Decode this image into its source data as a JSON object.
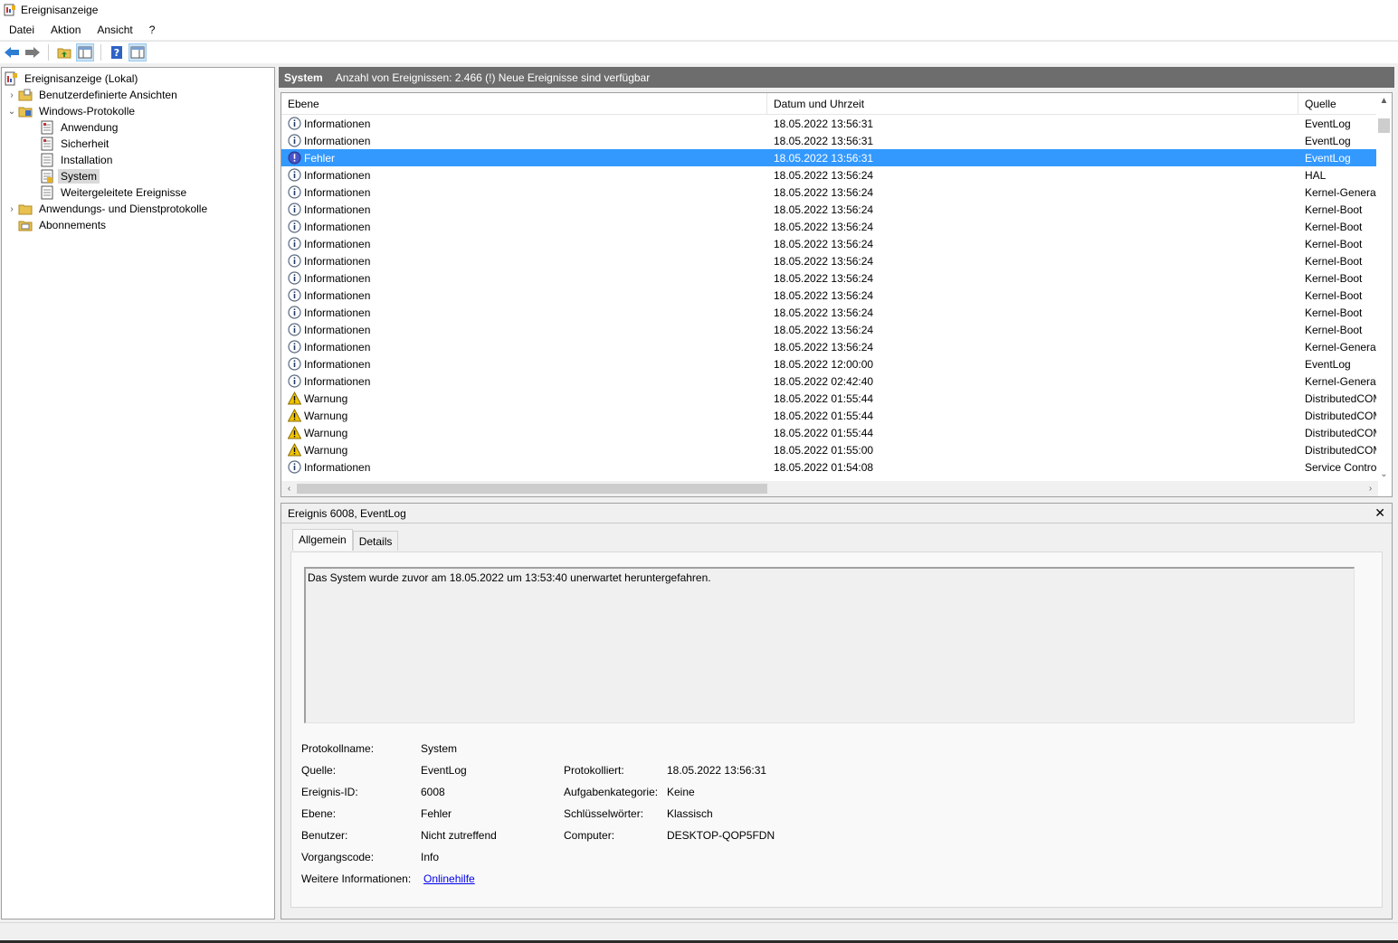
{
  "window": {
    "title": "Ereignisanzeige"
  },
  "menu": [
    "Datei",
    "Aktion",
    "Ansicht",
    "?"
  ],
  "tree": [
    {
      "label": "Ereignisanzeige (Lokal)",
      "level": 0,
      "arrow": "",
      "icon": "event-viewer-icon"
    },
    {
      "label": "Benutzerdefinierte Ansichten",
      "level": 1,
      "arrow": "›",
      "icon": "folder-icon"
    },
    {
      "label": "Windows-Protokolle",
      "level": 1,
      "arrow": "⌄",
      "icon": "folder-icon"
    },
    {
      "label": "Anwendung",
      "level": 2,
      "arrow": "",
      "icon": "log-icon"
    },
    {
      "label": "Sicherheit",
      "level": 2,
      "arrow": "",
      "icon": "log-icon"
    },
    {
      "label": "Installation",
      "level": 2,
      "arrow": "",
      "icon": "log-icon"
    },
    {
      "label": "System",
      "level": 2,
      "arrow": "",
      "icon": "log-icon",
      "selected": true
    },
    {
      "label": "Weitergeleitete Ereignisse",
      "level": 2,
      "arrow": "",
      "icon": "log-icon"
    },
    {
      "label": "Anwendungs- und Dienstprotokolle",
      "level": 1,
      "arrow": "›",
      "icon": "folder-icon"
    },
    {
      "label": "Abonnements",
      "level": 1,
      "arrow": "",
      "icon": "subscription-icon"
    }
  ],
  "header": {
    "title": "System",
    "info": "Anzahl von Ereignissen: 2.466 (!) Neue Ereignisse sind verfügbar"
  },
  "columns": [
    "Ebene",
    "Datum und Uhrzeit",
    "Quelle"
  ],
  "events": [
    {
      "level": "Informationen",
      "type": "info",
      "date": "18.05.2022 13:56:31",
      "source": "EventLog"
    },
    {
      "level": "Informationen",
      "type": "info",
      "date": "18.05.2022 13:56:31",
      "source": "EventLog"
    },
    {
      "level": "Fehler",
      "type": "error",
      "date": "18.05.2022 13:56:31",
      "source": "EventLog",
      "selected": true
    },
    {
      "level": "Informationen",
      "type": "info",
      "date": "18.05.2022 13:56:24",
      "source": "HAL"
    },
    {
      "level": "Informationen",
      "type": "info",
      "date": "18.05.2022 13:56:24",
      "source": "Kernel-General"
    },
    {
      "level": "Informationen",
      "type": "info",
      "date": "18.05.2022 13:56:24",
      "source": "Kernel-Boot"
    },
    {
      "level": "Informationen",
      "type": "info",
      "date": "18.05.2022 13:56:24",
      "source": "Kernel-Boot"
    },
    {
      "level": "Informationen",
      "type": "info",
      "date": "18.05.2022 13:56:24",
      "source": "Kernel-Boot"
    },
    {
      "level": "Informationen",
      "type": "info",
      "date": "18.05.2022 13:56:24",
      "source": "Kernel-Boot"
    },
    {
      "level": "Informationen",
      "type": "info",
      "date": "18.05.2022 13:56:24",
      "source": "Kernel-Boot"
    },
    {
      "level": "Informationen",
      "type": "info",
      "date": "18.05.2022 13:56:24",
      "source": "Kernel-Boot"
    },
    {
      "level": "Informationen",
      "type": "info",
      "date": "18.05.2022 13:56:24",
      "source": "Kernel-Boot"
    },
    {
      "level": "Informationen",
      "type": "info",
      "date": "18.05.2022 13:56:24",
      "source": "Kernel-Boot"
    },
    {
      "level": "Informationen",
      "type": "info",
      "date": "18.05.2022 13:56:24",
      "source": "Kernel-General"
    },
    {
      "level": "Informationen",
      "type": "info",
      "date": "18.05.2022 12:00:00",
      "source": "EventLog"
    },
    {
      "level": "Informationen",
      "type": "info",
      "date": "18.05.2022 02:42:40",
      "source": "Kernel-General"
    },
    {
      "level": "Warnung",
      "type": "warning",
      "date": "18.05.2022 01:55:44",
      "source": "DistributedCOM"
    },
    {
      "level": "Warnung",
      "type": "warning",
      "date": "18.05.2022 01:55:44",
      "source": "DistributedCOM"
    },
    {
      "level": "Warnung",
      "type": "warning",
      "date": "18.05.2022 01:55:44",
      "source": "DistributedCOM"
    },
    {
      "level": "Warnung",
      "type": "warning",
      "date": "18.05.2022 01:55:00",
      "source": "DistributedCOM"
    },
    {
      "level": "Informationen",
      "type": "info",
      "date": "18.05.2022 01:54:08",
      "source": "Service Control Manager"
    }
  ],
  "detail": {
    "title": "Ereignis 6008, EventLog",
    "close": "✕",
    "tabs": [
      "Allgemein",
      "Details"
    ],
    "message": "Das System wurde zuvor am 18.05.2022 um 13:53:40 unerwartet heruntergefahren.",
    "props": {
      "protokollname_label": "Protokollname:",
      "protokollname": "System",
      "quelle_label": "Quelle:",
      "quelle": "EventLog",
      "protokolliert_label": "Protokolliert:",
      "protokolliert": "18.05.2022 13:56:31",
      "ereignisid_label": "Ereignis-ID:",
      "ereignisid": "6008",
      "aufgabe_label": "Aufgabenkategorie:",
      "aufgabe": "Keine",
      "ebene_label": "Ebene:",
      "ebene": "Fehler",
      "schluessel_label": "Schlüsselwörter:",
      "schluessel": "Klassisch",
      "benutzer_label": "Benutzer:",
      "benutzer": "Nicht zutreffend",
      "computer_label": "Computer:",
      "computer": "DESKTOP-QOP5FDN",
      "vorgang_label": "Vorgangscode:",
      "vorgang": "Info",
      "weitere_label": "Weitere Informationen:",
      "weitere_link": "Onlinehilfe"
    }
  },
  "colors": {
    "selection": "#3399ff",
    "header_bar": "#6d6d6d",
    "info": "#1f5fa8",
    "error": "#4a52c8",
    "warning": "#f2c400"
  }
}
